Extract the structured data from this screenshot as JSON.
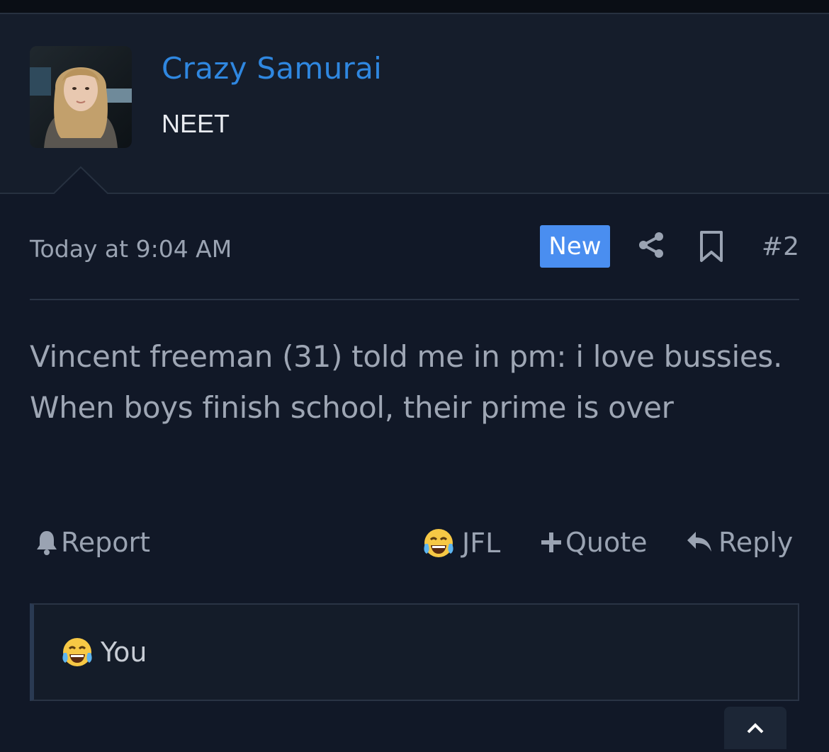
{
  "user": {
    "name": "Crazy Samurai",
    "title": "NEET"
  },
  "post": {
    "date": "Today at 9:04 AM",
    "badge": "New",
    "number": "#2",
    "message": "Vincent freeman (31) told me in pm: i love bussies. When boys finish school, their prime is over"
  },
  "actions": {
    "report": "Report",
    "reaction": "JFL",
    "quote": "Quote",
    "reply": "Reply"
  },
  "reactions": {
    "summary": "You"
  },
  "colors": {
    "background": "#111827",
    "header_background": "#151d2b",
    "username": "#2f87e0",
    "badge": "#4a8ef0",
    "muted_text": "#9aa3b2"
  },
  "icons": [
    "share-icon",
    "bookmark-icon",
    "bell-icon",
    "laughing-crying-emoji-icon",
    "plus-icon",
    "reply-arrow-icon",
    "chevron-up-icon"
  ]
}
